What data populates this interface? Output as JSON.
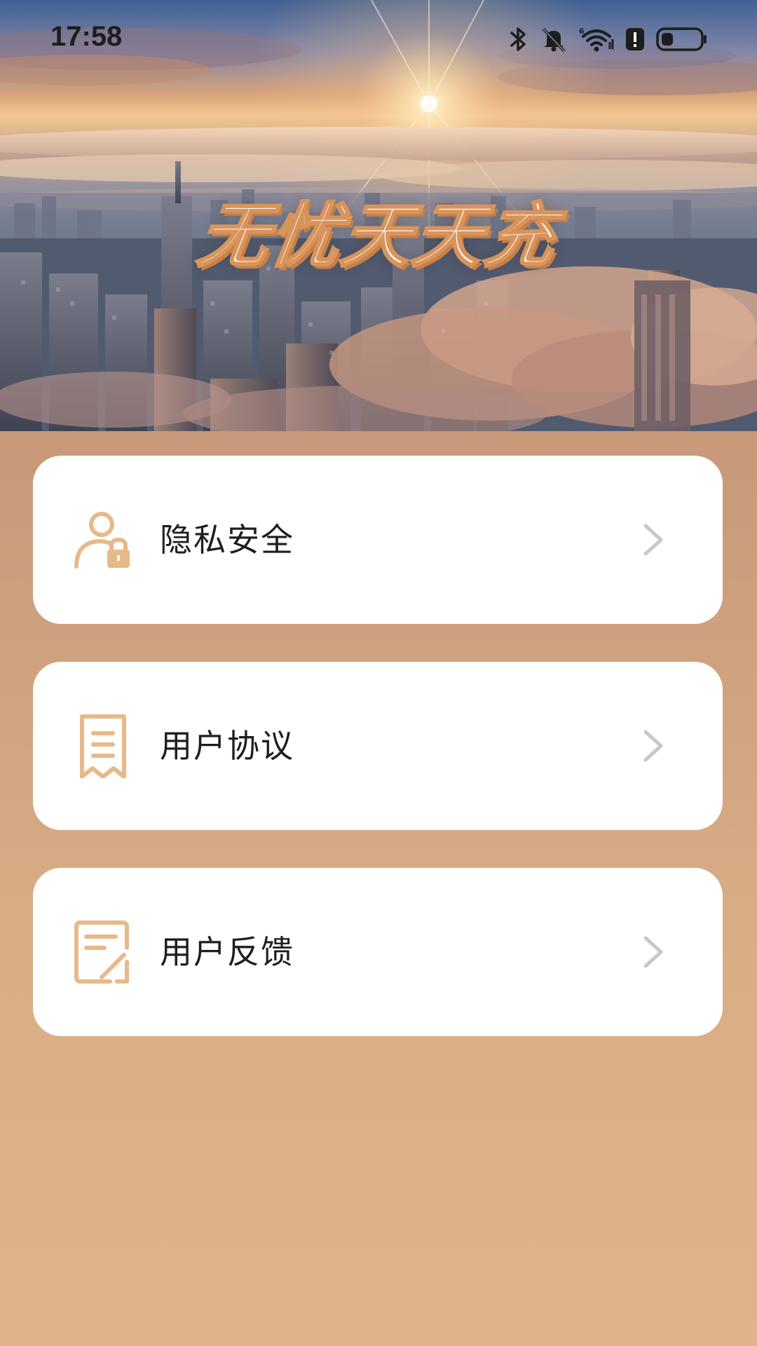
{
  "status_bar": {
    "time": "17:58",
    "icons": [
      "bluetooth-icon",
      "mute-bell-icon",
      "wifi-icon",
      "alert-icon",
      "battery-icon"
    ]
  },
  "hero": {
    "title": "无忧天天充"
  },
  "menu": {
    "items": [
      {
        "label": "隐私安全",
        "icon": "user-lock-icon"
      },
      {
        "label": "用户协议",
        "icon": "receipt-document-icon"
      },
      {
        "label": "用户反馈",
        "icon": "edit-document-icon"
      }
    ]
  },
  "colors": {
    "accent": "#e7b98a",
    "chevron": "#c8c8c8",
    "card_bg": "#ffffff",
    "page_bg_top": "#b9876e",
    "page_bg_bottom": "#dfb38b"
  }
}
